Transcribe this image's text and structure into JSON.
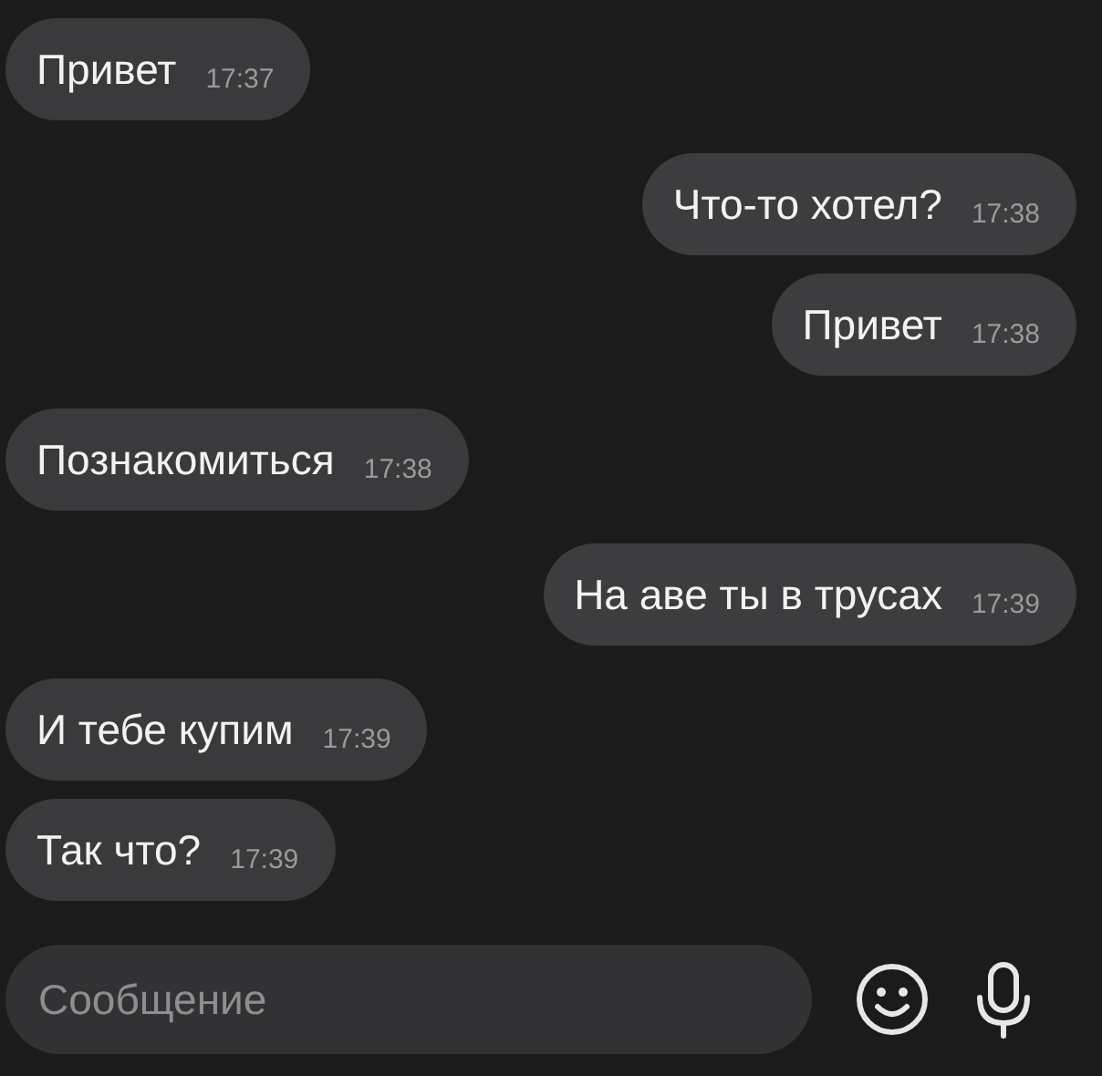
{
  "messages": [
    {
      "kind": "incoming",
      "text": "Привет",
      "time": "17:37"
    },
    {
      "kind": "outgoing",
      "text": "Что-то хотел?",
      "time": "17:38"
    },
    {
      "kind": "outgoing",
      "text": "Привет",
      "time": "17:38"
    },
    {
      "kind": "incoming",
      "text": "Познакомиться",
      "time": "17:38"
    },
    {
      "kind": "outgoing",
      "text": "На аве ты в трусах",
      "time": "17:39"
    },
    {
      "kind": "incoming",
      "text": "И тебе купим",
      "time": "17:39"
    },
    {
      "kind": "incoming",
      "text": "Так что?",
      "time": "17:39"
    }
  ],
  "composer": {
    "placeholder": "Сообщение"
  }
}
